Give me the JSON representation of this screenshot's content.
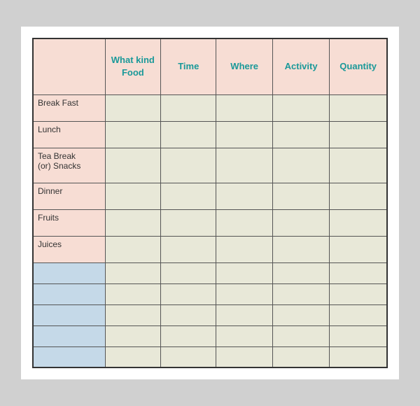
{
  "table": {
    "headers": [
      "",
      "What kind\nFood",
      "Time",
      "Where",
      "Activity",
      "Quantity"
    ],
    "rows": [
      {
        "label": "Break Fast",
        "type": "normal"
      },
      {
        "label": "Lunch",
        "type": "normal"
      },
      {
        "label": "Tea Break\n(or) Snacks",
        "type": "tall"
      },
      {
        "label": "Dinner",
        "type": "normal"
      },
      {
        "label": "Fruits",
        "type": "normal"
      },
      {
        "label": "Juices",
        "type": "normal"
      },
      {
        "label": "",
        "type": "short",
        "blue": true
      },
      {
        "label": "",
        "type": "short",
        "blue": true
      },
      {
        "label": "",
        "type": "short",
        "blue": true
      },
      {
        "label": "",
        "type": "short",
        "blue": true
      },
      {
        "label": "",
        "type": "short",
        "blue": true
      }
    ]
  }
}
